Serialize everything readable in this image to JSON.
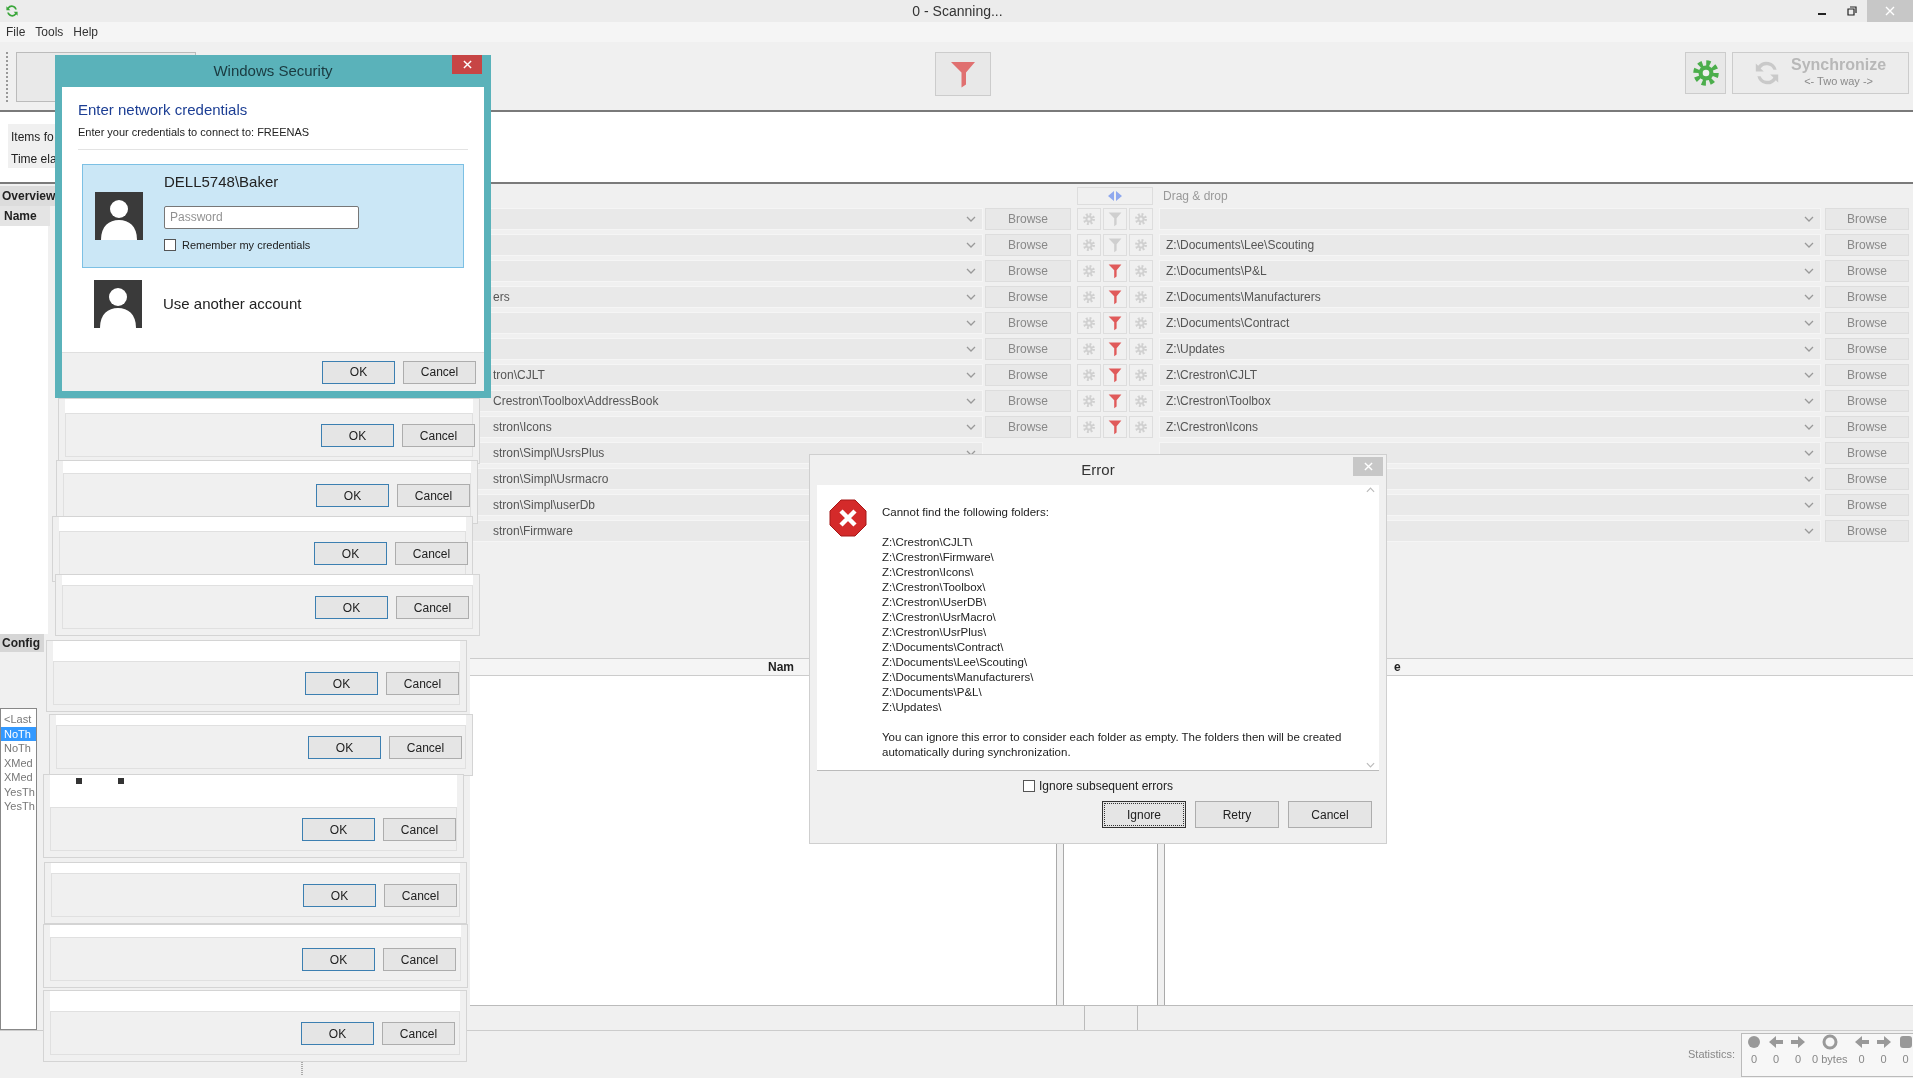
{
  "window": {
    "title": "0 - Scanning..."
  },
  "menu": [
    {
      "label": "File"
    },
    {
      "label": "Tools"
    },
    {
      "label": "Help"
    }
  ],
  "toolbar": {
    "sync_label": "Synchronize",
    "sync_mode": "<- Two way ->"
  },
  "progress": {
    "items_label": "Items fo",
    "time_label": "Time ela"
  },
  "left_panel": {
    "overview_tab": "Overview",
    "name_header": "Name",
    "config_header": "Config",
    "configs": [
      {
        "label": "<Last",
        "selected": false
      },
      {
        "label": "NoTh",
        "selected": true
      },
      {
        "label": "NoTh",
        "selected": false
      },
      {
        "label": "XMed",
        "selected": false
      },
      {
        "label": "XMed",
        "selected": false
      },
      {
        "label": "YesTh",
        "selected": false
      },
      {
        "label": "YesTh",
        "selected": false
      }
    ]
  },
  "folder_pairs": {
    "right_header": "Drag & drop",
    "rows": [
      {
        "left": "",
        "left_browse": "Browse",
        "filter_active": false,
        "right": "",
        "right_browse": "Browse"
      },
      {
        "left": "",
        "left_browse": "Browse",
        "filter_active": false,
        "right": "Z:\\Documents\\Lee\\Scouting",
        "right_browse": "Browse"
      },
      {
        "left": "",
        "left_browse": "Browse",
        "filter_active": true,
        "right": "Z:\\Documents\\P&L",
        "right_browse": "Browse"
      },
      {
        "left": "ers",
        "left_browse": "Browse",
        "filter_active": true,
        "right": "Z:\\Documents\\Manufacturers",
        "right_browse": "Browse"
      },
      {
        "left": "",
        "left_browse": "Browse",
        "filter_active": true,
        "right": "Z:\\Documents\\Contract",
        "right_browse": "Browse"
      },
      {
        "left": "",
        "left_browse": "Browse",
        "filter_active": true,
        "right": "Z:\\Updates",
        "right_browse": "Browse"
      },
      {
        "left": "tron\\CJLT",
        "left_browse": "Browse",
        "filter_active": true,
        "right": "Z:\\Crestron\\CJLT",
        "right_browse": "Browse"
      },
      {
        "left": "Crestron\\Toolbox\\AddressBook",
        "left_browse": "Browse",
        "filter_active": true,
        "right": "Z:\\Crestron\\Toolbox",
        "right_browse": "Browse"
      },
      {
        "left": "stron\\Icons",
        "left_browse": "Browse",
        "filter_active": true,
        "right": "Z:\\Crestron\\Icons",
        "right_browse": "Browse"
      },
      {
        "left": "stron\\Simpl\\UsrsPlus",
        "right_browse": "Browse"
      },
      {
        "left": "stron\\Simpl\\Usrmacro",
        "right_browse": "Browse"
      },
      {
        "left": "stron\\Simpl\\userDb",
        "right_browse": "Browse"
      },
      {
        "left": "stron\\Firmware",
        "right_browse": "Browse"
      }
    ]
  },
  "grid": {
    "column_1": "Nam",
    "column_2": "e"
  },
  "statistics": {
    "label": "Statistics:",
    "counts": [
      "0",
      "0",
      "0",
      "0 bytes",
      "0",
      "0",
      "0"
    ]
  },
  "credentials_dialog": {
    "title": "Windows Security",
    "heading": "Enter network credentials",
    "subtitle": "Enter your credentials to connect to: FREENAS",
    "user": "DELL5748\\Baker",
    "password_placeholder": "Password",
    "remember_label": "Remember my credentials",
    "remember_checked": false,
    "other_account": "Use another account",
    "ok": "OK",
    "cancel": "Cancel"
  },
  "ghost_dialogs": [
    {
      "ok": "OK",
      "cancel": "Cancel"
    },
    {
      "ok": "OK",
      "cancel": "Cancel"
    },
    {
      "ok": "OK",
      "cancel": "Cancel"
    },
    {
      "ok": "OK",
      "cancel": "Cancel"
    },
    {
      "ok": "OK",
      "cancel": "Cancel"
    },
    {
      "ok": "OK",
      "cancel": "Cancel"
    },
    {
      "ok": "OK",
      "cancel": "Cancel"
    },
    {
      "ok": "OK",
      "cancel": "Cancel"
    },
    {
      "ok": "OK",
      "cancel": "Cancel"
    },
    {
      "ok": "OK",
      "cancel": "Cancel"
    }
  ],
  "error_dialog": {
    "title": "Error",
    "message": "Cannot find the following folders:",
    "folders": [
      "Z:\\Crestron\\CJLT\\",
      "Z:\\Crestron\\Firmware\\",
      "Z:\\Crestron\\Icons\\",
      "Z:\\Crestron\\Toolbox\\",
      "Z:\\Crestron\\UserDB\\",
      "Z:\\Crestron\\UsrMacro\\",
      "Z:\\Crestron\\UsrPlus\\",
      "Z:\\Documents\\Contract\\",
      "Z:\\Documents\\Lee\\Scouting\\",
      "Z:\\Documents\\Manufacturers\\",
      "Z:\\Documents\\P&L\\",
      "Z:\\Updates\\"
    ],
    "hint": "You can ignore this error to consider each folder as empty. The folders then will be created automatically during synchronization.",
    "ignore_label": "Ignore subsequent errors",
    "ignore_checked": false,
    "buttons": [
      {
        "label": "Ignore",
        "selected": true
      },
      {
        "label": "Retry",
        "selected": false
      },
      {
        "label": "Cancel",
        "selected": false
      }
    ]
  }
}
